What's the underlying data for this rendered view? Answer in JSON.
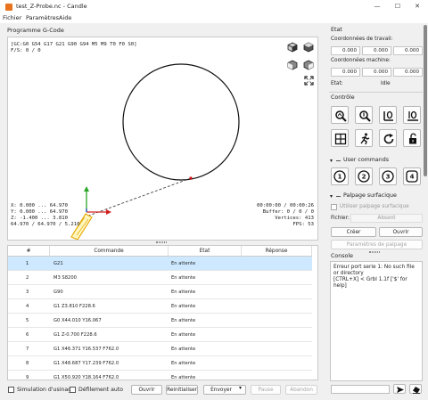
{
  "window": {
    "title": "test_Z-Probe.nc - Candle"
  },
  "menu": [
    "Fichier",
    "Paramètres",
    "Aide"
  ],
  "gcode_panel": {
    "title": "Programme G-Code",
    "parser_state": "[GC:G0 G54 G17 G21 G90 G94 M5 M9 T0 F0 S0]",
    "fs": "F/S: 0 / 0",
    "x_range": "X: 0.000 ... 64.970",
    "y_range": "Y: 0.000 ... 64.970",
    "z_range": "Z: -1.400 ... 3.810",
    "dims": "64.970 / 64.970 / 5.210",
    "time": "00:00:00 / 00:00:26",
    "buffer": "Buffer: 0 / 0 / 0",
    "vertices": "Vertices: 413",
    "fps": "FPS: 53"
  },
  "table": {
    "headers": [
      "#",
      "Commande",
      "Etat",
      "Réponse"
    ],
    "rows": [
      {
        "n": "1",
        "cmd": "G21",
        "state": "En attente",
        "resp": ""
      },
      {
        "n": "2",
        "cmd": "M3 S8200",
        "state": "En attente",
        "resp": ""
      },
      {
        "n": "3",
        "cmd": "G90",
        "state": "En attente",
        "resp": ""
      },
      {
        "n": "4",
        "cmd": "G1 Z3.810 F228.6",
        "state": "En attente",
        "resp": ""
      },
      {
        "n": "5",
        "cmd": "G0 X44.010 Y16.067",
        "state": "En attente",
        "resp": ""
      },
      {
        "n": "6",
        "cmd": "G1 Z-0.700 F228.6",
        "state": "En attente",
        "resp": ""
      },
      {
        "n": "7",
        "cmd": "G1 X46.371 Y16.537 F762.0",
        "state": "En attente",
        "resp": ""
      },
      {
        "n": "8",
        "cmd": "G1 X48.687 Y17.239 F762.0",
        "state": "En attente",
        "resp": ""
      },
      {
        "n": "9",
        "cmd": "G1 X50.920 Y18.164 F762.0",
        "state": "En attente",
        "resp": ""
      }
    ]
  },
  "bottom": {
    "sim": "Simulation d'usinage",
    "autoscroll": "Défilement auto",
    "open": "Ouvrir",
    "reset": "Reinitialiser",
    "send": "Envoyer",
    "pause": "Pause",
    "abort": "Abandon"
  },
  "state": {
    "title": "Etat",
    "work_label": "Coordonnées de travail:",
    "work": [
      "0.000",
      "0.000",
      "0.000"
    ],
    "machine_label": "Coordonnées machine:",
    "machine": [
      "0.000",
      "0.000",
      "0.000"
    ],
    "status_label": "Etat:",
    "status": "Idle"
  },
  "control": {
    "title": "Contrôle"
  },
  "user_commands": {
    "title": "User commands",
    "buttons": [
      "1",
      "2",
      "3",
      "4"
    ]
  },
  "heightmap": {
    "title": "Palpage surfacique",
    "use": "Utiliser palpage surfacique",
    "file_label": "Fichier:",
    "file_value": "Absent",
    "create": "Créer",
    "open": "Ouvrir",
    "params": "Paramètres de palpage"
  },
  "console": {
    "title": "Console",
    "lines": [
      "Erreur port serie 1: No such file or directory",
      "[CTRL+X] < Grbl 1.1f ['$' for help]"
    ]
  },
  "colors": {
    "accent": "#3c8be6",
    "selected_row": "#cde8ff",
    "tool": "#e6a700",
    "path": "#444444"
  }
}
